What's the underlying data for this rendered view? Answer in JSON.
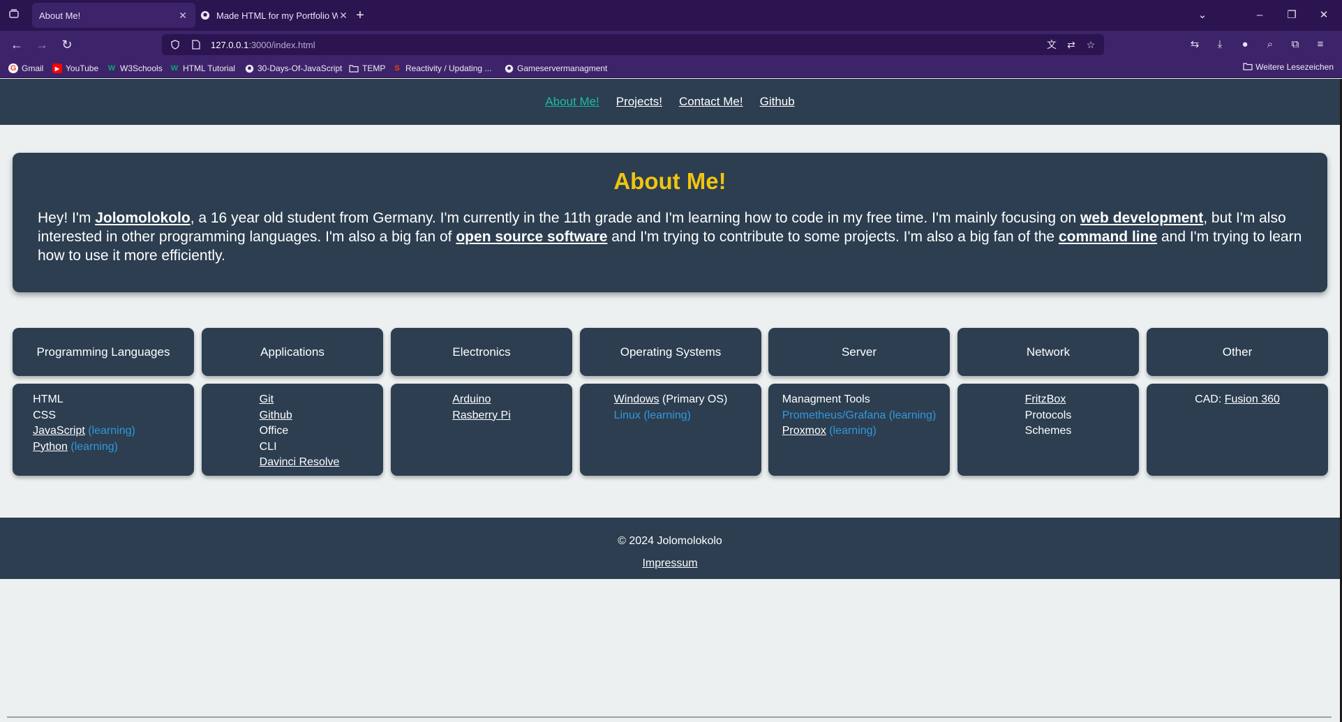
{
  "browser": {
    "tabs": [
      {
        "title": "About Me!",
        "active": true
      },
      {
        "title": "Made HTML for my Portfolio W",
        "active": false
      }
    ],
    "url": {
      "host": "127.0.0.1",
      "path": ":3000/index.html"
    },
    "bookmarks": [
      {
        "label": "Gmail",
        "icon": "google-icon"
      },
      {
        "label": "YouTube",
        "icon": "youtube-icon"
      },
      {
        "label": "W3Schools",
        "icon": "w3schools-icon"
      },
      {
        "label": "HTML Tutorial",
        "icon": "w3schools-icon"
      },
      {
        "label": "30-Days-Of-JavaScript",
        "icon": "github-icon"
      },
      {
        "label": "TEMP",
        "icon": "folder-icon"
      },
      {
        "label": "Reactivity / Updating ...",
        "icon": "svelte-icon"
      },
      {
        "label": "Gameservermanagment",
        "icon": "github-icon"
      }
    ],
    "other_bookmarks": "Weitere Lesezeichen",
    "colors": {
      "chrome_dark": "#2b1450",
      "chrome": "#3d2369"
    }
  },
  "site": {
    "nav": [
      "About Me!",
      "Projects!",
      "Contact Me!",
      "Github"
    ],
    "about": {
      "title": "About Me!",
      "p1": "Hey! I'm ",
      "name": "Jolomolokolo",
      "p2": ", a 16 year old student from Germany. I'm currently in the 11th grade and I'm learning how to code in my free time. I'm mainly focusing on ",
      "webdev": "web development",
      "p3": ", but I'm also interested in other programming languages. I'm also a big fan of ",
      "oss": "open source software",
      "p4": " and I'm trying to contribute to some projects. I'm also a big fan of the ",
      "cli": "command line",
      "p5": " and I'm trying to learn how to use it more efficiently."
    },
    "categories": [
      "Programming Languages",
      "Applications",
      "Electronics",
      "Operating Systems",
      "Server",
      "Network",
      "Other"
    ],
    "lists": {
      "programming": [
        "HTML",
        "CSS",
        "JavaScript",
        "Python"
      ],
      "applications": [
        "Git",
        "Github",
        "Office",
        "CLI",
        "Davinci Resolve"
      ],
      "electronics": [
        "Arduino",
        "Rasberry Pi"
      ],
      "os": {
        "windows": "Windows",
        "windows_note": " (Primary OS)",
        "linux": "Linux (learning)"
      },
      "server": {
        "mgmt": "Managment Tools",
        "prom": "Prometheus/Grafana (learning)",
        "proxmox": "Proxmox"
      },
      "network": [
        "FritzBox",
        "Protocols",
        "Schemes"
      ],
      "other": {
        "prefix": "CAD: ",
        "fusion": "Fusion 360"
      },
      "learning": " (learning)"
    },
    "footer": {
      "copyright": "© 2024 Jolomolokolo",
      "impressum": "Impressum"
    },
    "colors": {
      "primary": "#2c3e50",
      "accent": "#f1c40f",
      "link_active": "#1abc9c",
      "learning": "#3498db",
      "background": "#ecf0f1"
    }
  }
}
